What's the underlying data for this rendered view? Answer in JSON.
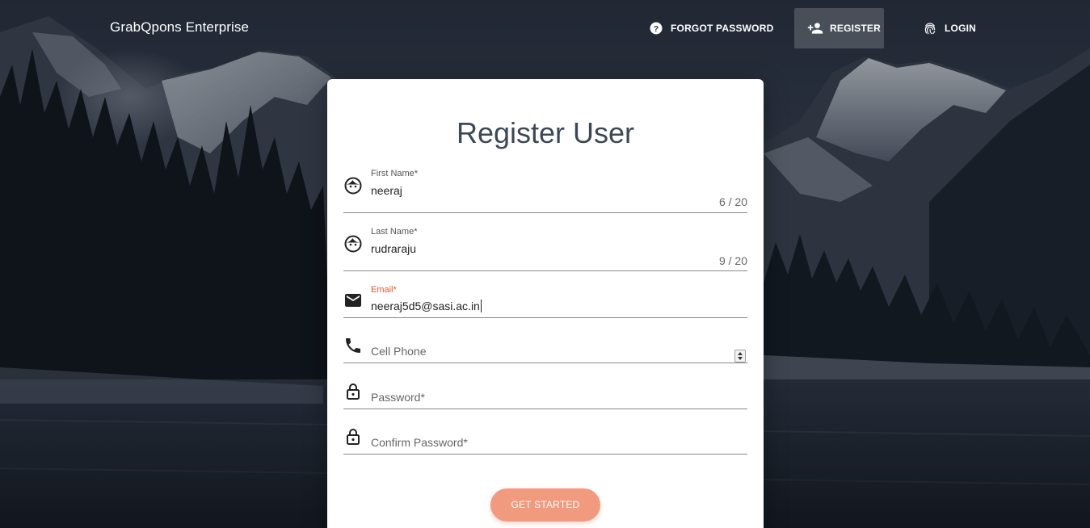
{
  "nav": {
    "brand": "GrabQpons Enterprise",
    "forgot_password": {
      "label": "FORGOT PASSWORD",
      "icon": "help-circle-icon"
    },
    "register": {
      "label": "REGISTER",
      "icon": "person-add-icon"
    },
    "login": {
      "label": "LOGIN",
      "icon": "fingerprint-icon"
    }
  },
  "form": {
    "title": "Register User",
    "first_name": {
      "label": "First Name*",
      "value": "neeraj",
      "counter": "6 / 20",
      "icon": "face-icon"
    },
    "last_name": {
      "label": "Last Name*",
      "value": "rudraraju",
      "counter": "9 / 20",
      "icon": "face-icon"
    },
    "email": {
      "label": "Email*",
      "value": "neeraj5d5@sasi.ac.in",
      "icon": "mail-icon",
      "focused": true
    },
    "cell_phone": {
      "placeholder": "Cell Phone",
      "icon": "phone-icon"
    },
    "password": {
      "placeholder": "Password*",
      "icon": "lock-icon"
    },
    "confirm_password": {
      "placeholder": "Confirm Password*",
      "icon": "lock-icon"
    },
    "submit_label": "GET STARTED"
  },
  "colors": {
    "accent": "#e4572e",
    "button": "#f29a7e",
    "title": "#3c4858"
  }
}
